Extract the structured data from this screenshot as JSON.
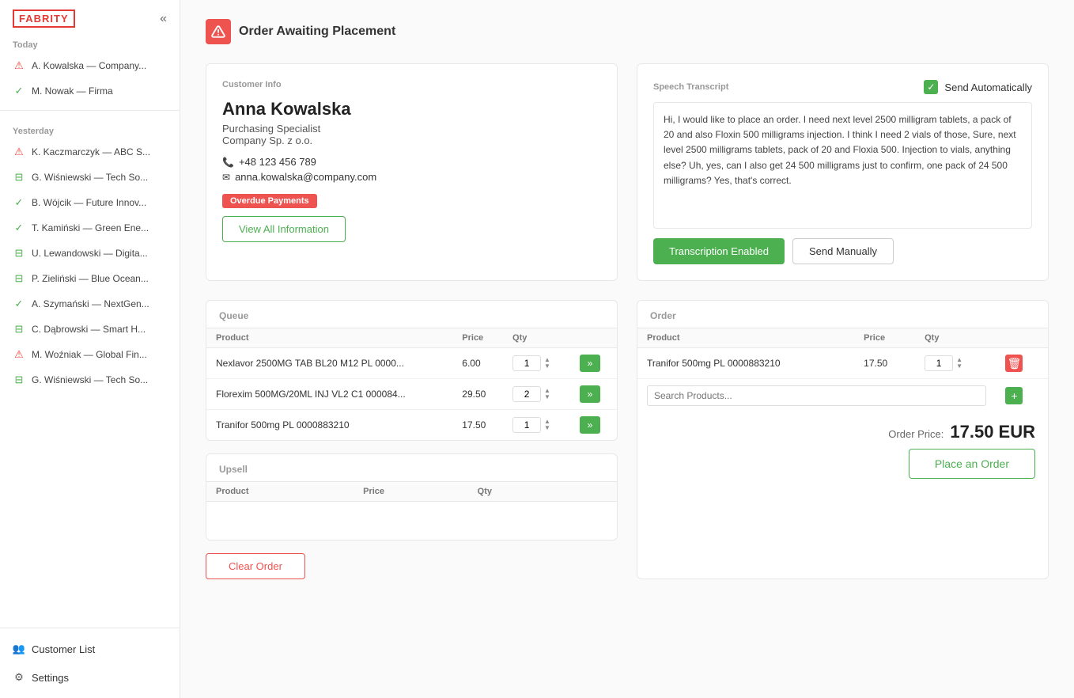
{
  "app": {
    "logo": "FABRITY",
    "collapse_icon": "«"
  },
  "sidebar": {
    "today_label": "Today",
    "yesterday_label": "Yesterday",
    "today_items": [
      {
        "icon": "warning",
        "name": "A. Kowalska — Company...",
        "status": "warning"
      },
      {
        "icon": "check",
        "name": "M. Nowak — Firma",
        "status": "check"
      }
    ],
    "yesterday_items": [
      {
        "icon": "warning",
        "name": "K. Kaczmarczyk — ABC S...",
        "status": "warning"
      },
      {
        "icon": "chat",
        "name": "G. Wiśniewski — Tech So...",
        "status": "chat"
      },
      {
        "icon": "check",
        "name": "B. Wójcik — Future Innov...",
        "status": "check"
      },
      {
        "icon": "check",
        "name": "T. Kamiński — Green Ene...",
        "status": "check"
      },
      {
        "icon": "chat",
        "name": "U. Lewandowski — Digita...",
        "status": "chat"
      },
      {
        "icon": "chat",
        "name": "P. Zieliński — Blue Ocean...",
        "status": "chat"
      },
      {
        "icon": "check",
        "name": "A. Szymański — NextGen...",
        "status": "check"
      },
      {
        "icon": "chat",
        "name": "C. Dąbrowski — Smart H...",
        "status": "chat"
      },
      {
        "icon": "warning",
        "name": "M. Woźniak — Global Fin...",
        "status": "warning"
      },
      {
        "icon": "chat",
        "name": "G. Wiśniewski — Tech So...",
        "status": "chat"
      }
    ],
    "bottom": [
      {
        "icon": "customers",
        "label": "Customer List"
      },
      {
        "icon": "settings",
        "label": "Settings"
      }
    ]
  },
  "header": {
    "order_awaiting": "Order Awaiting Placement"
  },
  "customer": {
    "section_title": "Customer Info",
    "name": "Anna Kowalska",
    "role": "Purchasing Specialist",
    "company": "Company Sp. z o.o.",
    "phone": "+48 123 456 789",
    "email": "anna.kowalska@company.com",
    "overdue_badge": "Overdue Payments",
    "view_all_btn": "View All Information"
  },
  "speech": {
    "title": "Speech Transcript",
    "send_auto_label": "Send Automatically",
    "transcript": "Hi, I would like to place an order. I need next level 2500 milligram tablets, a pack of 20 and also Floxin 500 milligrams injection. I think I need 2 vials of those, Sure, next level 2500 milligrams tablets, pack of 20 and Floxia 500. Injection to vials, anything else? Uh, yes, can I also get 24 500 milligrams just to confirm, one pack of 24 500 milligrams? Yes, that's correct.",
    "transcription_btn": "Transcription Enabled",
    "send_manually_btn": "Send Manually"
  },
  "queue": {
    "title": "Queue",
    "columns": [
      "Product",
      "Price",
      "Qty"
    ],
    "rows": [
      {
        "product": "Nexlavor 2500MG TAB BL20 M12 PL 0000...",
        "price": "6.00",
        "qty": "1"
      },
      {
        "product": "Florexim 500MG/20ML INJ VL2 C1 000084...",
        "price": "29.50",
        "qty": "2"
      },
      {
        "product": "Tranifor 500mg PL 0000883210",
        "price": "17.50",
        "qty": "1"
      }
    ]
  },
  "upsell": {
    "title": "Upsell",
    "columns": [
      "Product",
      "Price",
      "Qty"
    ]
  },
  "order": {
    "title": "Order",
    "columns": [
      "Product",
      "Price",
      "Qty"
    ],
    "rows": [
      {
        "product": "Tranifor 500mg PL 0000883210",
        "price": "17.50",
        "qty": "1"
      }
    ],
    "search_placeholder": "Search Products...",
    "price_label": "Order Price:",
    "price_value": "17.50 EUR",
    "place_order_btn": "Place an Order",
    "clear_order_btn": "Clear Order"
  }
}
